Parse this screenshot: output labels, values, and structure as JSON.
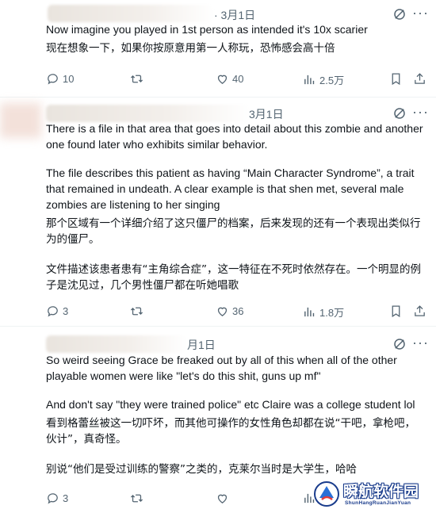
{
  "tweets": [
    {
      "date": "· 3月1日",
      "paragraphs": [
        "Now imagine you played in 1st person as intended it's 10x scarier",
        "现在想象一下，如果你按原意用第一人称玩，恐怖感会高十倍"
      ],
      "actions": {
        "replies": "10",
        "reposts": "",
        "likes": "40",
        "views": "2.5万"
      }
    },
    {
      "date": "3月1日",
      "paragraphs": [
        "There is a file in that area that goes into detail about this zombie and another one found later who exhibits similar behavior.",
        "The file describes this patient as having “Main Character Syndrome”, a trait that remained in undeath. A clear example is that shen met, several male zombies are listening to her singing",
        "那个区域有一个详细介绍了这只僵尸的档案，后来发现的还有一个表现出类似行为的僵尸。",
        "文件描述该患者患有“主角综合症”，这一特征在不死时依然存在。一个明显的例子是沈见过，几个男性僵尸都在听她唱歌"
      ],
      "actions": {
        "replies": "3",
        "reposts": "",
        "likes": "36",
        "views": "1.8万"
      }
    },
    {
      "date": "月1日",
      "paragraphs": [
        "So weird seeing Grace be freaked out by all of this when all of the other playable women were like \"let's do this shit, guns up mf\"",
        "And don't say \"they were trained police\" etc Claire was a college student lol",
        "看到格蕾丝被这一切吓坏，而其他可操作的女性角色却都在说“干吧，拿枪吧，伙计”，真奇怪。",
        "别说“他们是受过训练的警察”之类的，克莱尔当时是大学生，哈哈"
      ],
      "actions": {
        "replies": "3",
        "reposts": "",
        "likes": "",
        "views": ""
      }
    }
  ],
  "watermark": {
    "title": "瞬航软件园",
    "subtitle": "ShunHangRuanJianYuan"
  },
  "icons": [
    "grok-icon",
    "more-icon",
    "reply-icon",
    "repost-icon",
    "like-icon",
    "views-icon",
    "bookmark-icon",
    "share-icon"
  ],
  "colors": {
    "text": "#0f1419",
    "secondary": "#536471",
    "divider": "#eff3f4"
  }
}
